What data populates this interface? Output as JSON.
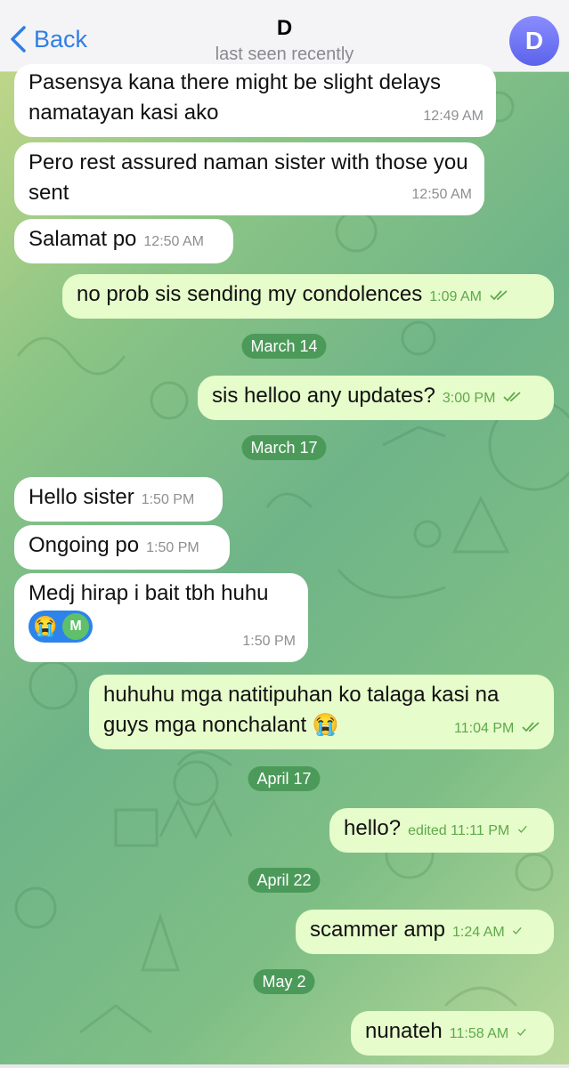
{
  "header": {
    "back_label": "Back",
    "title": "D",
    "subtitle": "last seen recently",
    "avatar_letter": "D"
  },
  "messages": [
    {
      "dir": "in",
      "text": "Pasensya kana there might be slight delays namatayan kasi ako",
      "time": "12:49 AM"
    },
    {
      "dir": "in",
      "text": "Pero rest assured naman sister with those you sent",
      "time": "12:50 AM"
    },
    {
      "dir": "in",
      "text": "Salamat po",
      "time": "12:50 AM"
    },
    {
      "dir": "out",
      "text": "no prob sis sending my condolences",
      "time": "1:09 AM",
      "status": "read"
    },
    {
      "date": "March 14"
    },
    {
      "dir": "out",
      "text": "sis helloo any updates?",
      "time": "3:00 PM",
      "status": "read"
    },
    {
      "date": "March 17"
    },
    {
      "dir": "in",
      "text": "Hello sister",
      "time": "1:50 PM"
    },
    {
      "dir": "in",
      "text": "Ongoing po",
      "time": "1:50 PM"
    },
    {
      "dir": "in",
      "text": "Medj hirap i bait tbh huhu",
      "time": "1:50 PM",
      "reaction": {
        "emoji": "😭",
        "user": "M"
      }
    },
    {
      "dir": "out",
      "text": "huhuhu mga natitipuhan ko talaga kasi na guys mga nonchalant 😭",
      "time": "11:04 PM",
      "status": "read"
    },
    {
      "date": "April 17"
    },
    {
      "dir": "out",
      "text": "hello?",
      "time": "edited 11:11 PM",
      "status": "sent"
    },
    {
      "date": "April 22"
    },
    {
      "dir": "out",
      "text": "scammer amp",
      "time": "1:24 AM",
      "status": "sent"
    },
    {
      "date": "May 2"
    },
    {
      "dir": "out",
      "text": "nunateh",
      "time": "11:58 AM",
      "status": "sent"
    }
  ],
  "colors": {
    "accent": "#2f7ee8",
    "out_bubble": "#e6fccb",
    "in_bubble": "#ffffff",
    "date_pill": "#4c9a5a"
  },
  "icons": {
    "back": "chevron-left-icon",
    "read": "double-check-icon",
    "sent": "single-check-icon"
  }
}
